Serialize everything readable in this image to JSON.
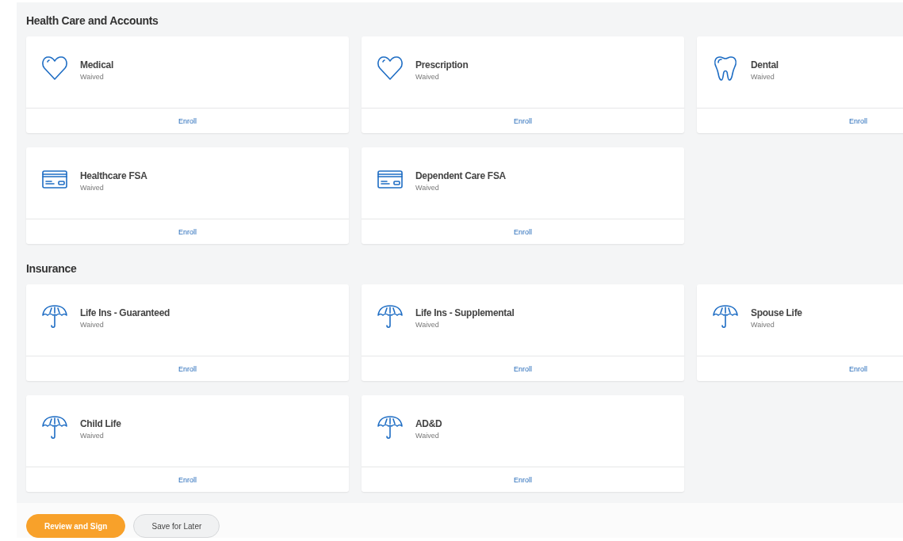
{
  "sections": [
    {
      "title": "Health Care and Accounts",
      "cards": [
        {
          "kind": "heart",
          "title": "Medical",
          "status": "Waived",
          "action": "Enroll"
        },
        {
          "kind": "heart",
          "title": "Prescription",
          "status": "Waived",
          "action": "Enroll"
        },
        {
          "kind": "tooth",
          "title": "Dental",
          "status": "Waived",
          "action": "Enroll"
        },
        {
          "kind": "card",
          "title": "Healthcare FSA",
          "status": "Waived",
          "action": "Enroll"
        },
        {
          "kind": "card",
          "title": "Dependent Care FSA",
          "status": "Waived",
          "action": "Enroll"
        }
      ]
    },
    {
      "title": "Insurance",
      "cards": [
        {
          "kind": "umbrella",
          "title": "Life Ins - Guaranteed",
          "status": "Waived",
          "action": "Enroll"
        },
        {
          "kind": "umbrella",
          "title": "Life Ins - Supplemental",
          "status": "Waived",
          "action": "Enroll"
        },
        {
          "kind": "umbrella",
          "title": "Spouse Life",
          "status": "Waived",
          "action": "Enroll"
        },
        {
          "kind": "umbrella",
          "title": "Child Life",
          "status": "Waived",
          "action": "Enroll"
        },
        {
          "kind": "umbrella",
          "title": "AD&D",
          "status": "Waived",
          "action": "Enroll"
        }
      ]
    }
  ],
  "buttons": [
    {
      "kind": "primary",
      "label": "Review and Sign"
    },
    {
      "kind": "secondary",
      "label": "Save for Later"
    }
  ]
}
